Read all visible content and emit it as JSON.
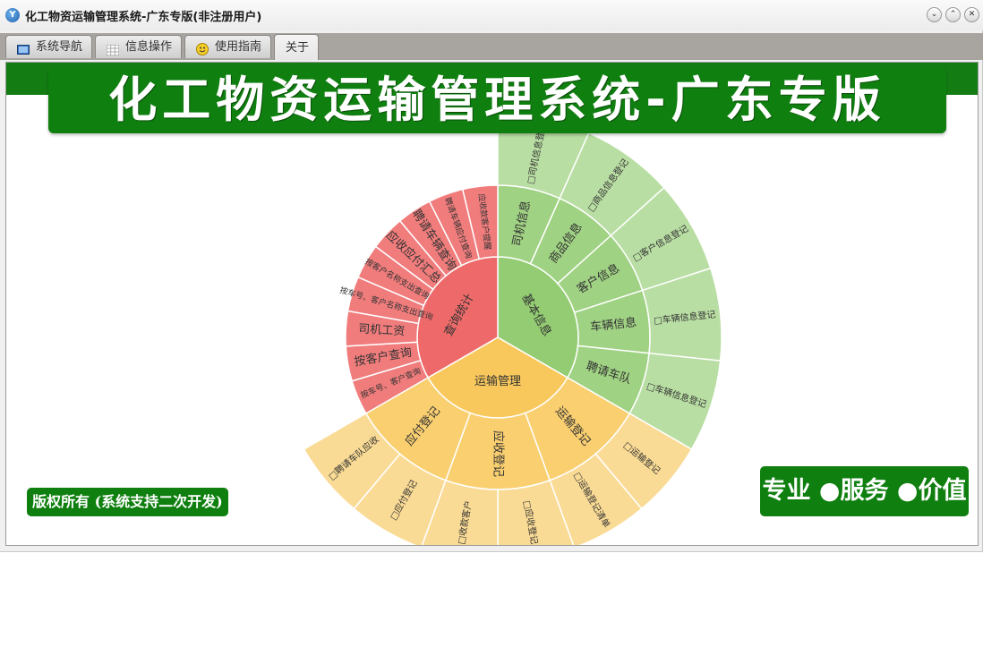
{
  "window": {
    "title": "化工物资运输管理系统-广东专版(非注册用户)",
    "app_icon_glyph": "Y"
  },
  "controls": {
    "help_glyph": "⌄",
    "minimize_glyph": "⌃",
    "close_glyph": "✕"
  },
  "tabs": [
    {
      "label": "系统导航",
      "icon": "monitor-icon"
    },
    {
      "label": "信息操作",
      "icon": "grid-icon"
    },
    {
      "label": "使用指南",
      "icon": "smiley-icon"
    },
    {
      "label": "关于",
      "icon": ""
    }
  ],
  "banner": {
    "title": "化工物资运输管理系统-广东专版"
  },
  "copyright": "版权所有 (系统支持二次开发)",
  "slogan": "专业 ●服务 ●价值",
  "colors": {
    "brand_green": "#0f7f0f",
    "basic_info": "#93cc72",
    "transport": "#f8c85c",
    "query": "#ee6a6a"
  },
  "chart_data": {
    "type": "sunburst",
    "rings": [
      {
        "name": "基本信息",
        "color": "#93cc72",
        "children": [
          {
            "name": "司机信息",
            "children": [
              {
                "name": "□司机信息登记"
              }
            ]
          },
          {
            "name": "商品信息",
            "children": [
              {
                "name": "□商品信息登记"
              }
            ]
          },
          {
            "name": "客户信息",
            "children": [
              {
                "name": "□客户信息登记"
              }
            ]
          },
          {
            "name": "车辆信息",
            "children": [
              {
                "name": "□车辆信息登记"
              }
            ]
          },
          {
            "name": "聘请车队",
            "children": [
              {
                "name": "□车辆信息登记"
              }
            ]
          }
        ]
      },
      {
        "name": "运输管理",
        "color": "#f8c85c",
        "children": [
          {
            "name": "运输登记",
            "children": [
              {
                "name": "□运输登记"
              },
              {
                "name": "□运输登记清单"
              }
            ]
          },
          {
            "name": "应收登记",
            "children": [
              {
                "name": "□应收登记"
              },
              {
                "name": "□收款客户"
              }
            ]
          },
          {
            "name": "应付登记",
            "children": [
              {
                "name": "□应付登记"
              },
              {
                "name": "□聘请车队应收"
              }
            ]
          }
        ]
      },
      {
        "name": "查询统计",
        "color": "#ee6a6a",
        "children": [
          {
            "name": "按车号、客户查询"
          },
          {
            "name": "按客户查询"
          },
          {
            "name": "司机工资"
          },
          {
            "name": "按车号、客户名称支出查询"
          },
          {
            "name": "按客户名称支出查询"
          },
          {
            "name": "应收应付汇总"
          },
          {
            "name": "聘请车辆查询"
          },
          {
            "name": "聘请车辆应付查询"
          },
          {
            "name": "应收款客户提醒"
          }
        ]
      }
    ]
  }
}
